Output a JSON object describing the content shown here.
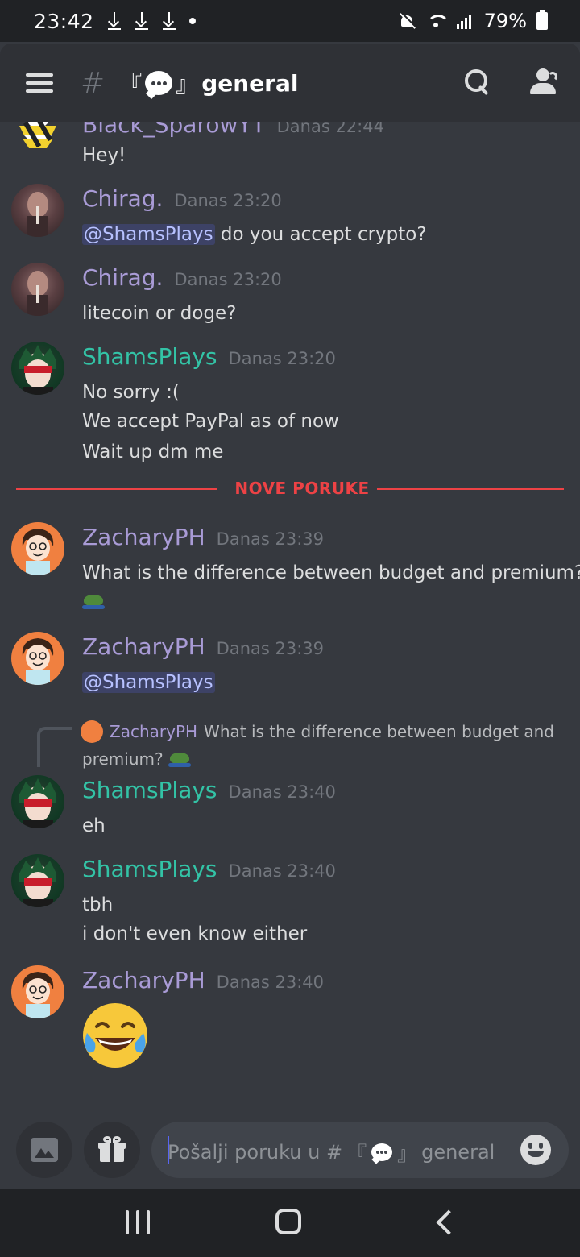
{
  "status_bar": {
    "time": "23:42",
    "battery": "79%",
    "icons": [
      "download-icon",
      "download-icon",
      "download-icon",
      "dot-icon",
      "mute-icon",
      "wifi-icon",
      "signal-icon",
      "battery-icon"
    ]
  },
  "header": {
    "hash": "#",
    "bracket_open": "『",
    "bracket_close": "』",
    "channel_name": "general",
    "icons": [
      "hamburger-icon",
      "speech-bubble-icon",
      "search-icon",
      "members-icon"
    ]
  },
  "colors": {
    "background": "#36393f",
    "header": "#2f3136",
    "bars": "#202225",
    "new_messages_red": "#ed4245",
    "username_purple": "#a99bd6",
    "username_teal": "#33c3a6",
    "mention_text": "#b7c1ff",
    "timestamp": "#72767d"
  },
  "messages": [
    {
      "author": "Black_SparowYT",
      "timestamp": "Danas 22:44",
      "lines": [
        "Hey!"
      ]
    },
    {
      "author": "Chirag.",
      "timestamp": "Danas 23:20",
      "mention": "@ShamsPlays",
      "lines": [
        "do you accept crypto?"
      ]
    },
    {
      "author": "Chirag.",
      "timestamp": "Danas 23:20",
      "lines": [
        "litecoin or doge?"
      ]
    },
    {
      "author": "ShamsPlays",
      "timestamp": "Danas 23:20",
      "lines": [
        "No sorry :(",
        "We accept PayPal as of now",
        "Wait up dm me"
      ]
    },
    {
      "author": "ZacharyPH",
      "timestamp": "Danas 23:39",
      "lines": [
        "What is the difference between budget and premium?"
      ],
      "emoji": "frog-emoji"
    },
    {
      "author": "ZacharyPH",
      "timestamp": "Danas 23:39",
      "mention": "@ShamsPlays"
    },
    {
      "reply_to": {
        "author": "ZacharyPH",
        "text_line1": "What is the difference between budget and",
        "text_line2": "premium?",
        "emoji": "frog-emoji"
      },
      "author": "ShamsPlays",
      "timestamp": "Danas 23:40",
      "lines": [
        "eh"
      ]
    },
    {
      "author": "ShamsPlays",
      "timestamp": "Danas 23:40",
      "lines": [
        "tbh",
        "i don't even know either"
      ]
    },
    {
      "author": "ZacharyPH",
      "timestamp": "Danas 23:40",
      "emoji": "joy-emoji"
    }
  ],
  "new_messages_divider": "NOVE PORUKE",
  "composer": {
    "placeholder_prefix": "Pošalji poruku u #",
    "bracket_open": "『",
    "bracket_close": "』",
    "channel": "general",
    "icons": [
      "image-icon",
      "gift-icon",
      "emoji-picker-icon"
    ]
  },
  "nav_bar": {
    "icons": [
      "recent-apps-icon",
      "home-icon",
      "back-icon"
    ]
  }
}
